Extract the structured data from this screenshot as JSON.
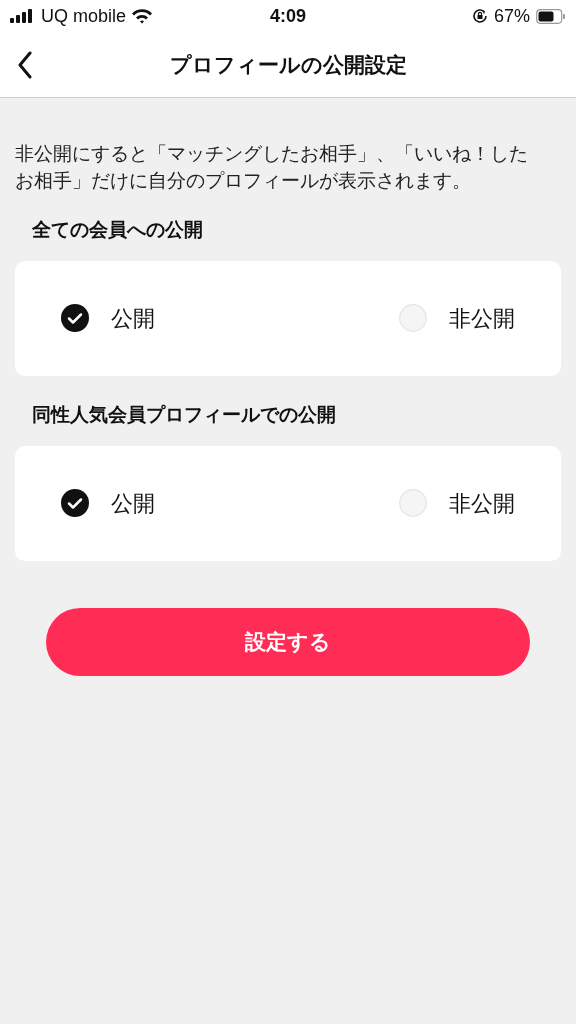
{
  "status_bar": {
    "carrier": "UQ mobile",
    "time": "4:09",
    "battery": "67%"
  },
  "header": {
    "title": "プロフィールの公開設定"
  },
  "description": "非公開にすると「マッチングしたお相手」、「いいね！したお相手」だけに自分のプロフィールが表示されます。",
  "sections": [
    {
      "heading": "全ての会員への公開",
      "options": [
        {
          "label": "公開",
          "selected": true
        },
        {
          "label": "非公開",
          "selected": false
        }
      ]
    },
    {
      "heading": "同性人気会員プロフィールでの公開",
      "options": [
        {
          "label": "公開",
          "selected": true
        },
        {
          "label": "非公開",
          "selected": false
        }
      ]
    }
  ],
  "submit_button": "設定する"
}
